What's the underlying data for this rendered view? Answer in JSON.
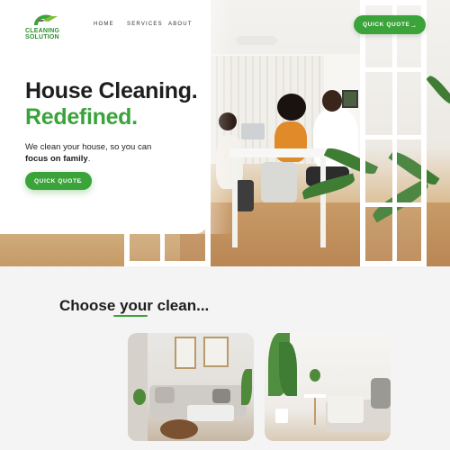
{
  "brand": {
    "logo_lines": [
      "CLEANING",
      "SOLUTION"
    ],
    "colors": {
      "accent": "#3aa33a",
      "text": "#1e1e1e",
      "background": "#f4f4f4"
    }
  },
  "nav": {
    "items": [
      {
        "label": "HOME"
      },
      {
        "label": "SERVICES"
      },
      {
        "label": "ABOUT"
      }
    ],
    "cta_label": "QUICK QUOTE",
    "cta_icon": "arrow-right-icon"
  },
  "hero": {
    "headline_line1": "House Cleaning.",
    "headline_line2": "Redefined.",
    "subtext_part1": "We clean your house, so you can",
    "subtext_bold": "focus on family",
    "subtext_end": ".",
    "cta_label": "QUICK QUOTE",
    "cta_icon": "arrow-right-icon"
  },
  "choose": {
    "title_start": "Choose ",
    "title_emphasis": "your",
    "title_end": " clean..."
  }
}
